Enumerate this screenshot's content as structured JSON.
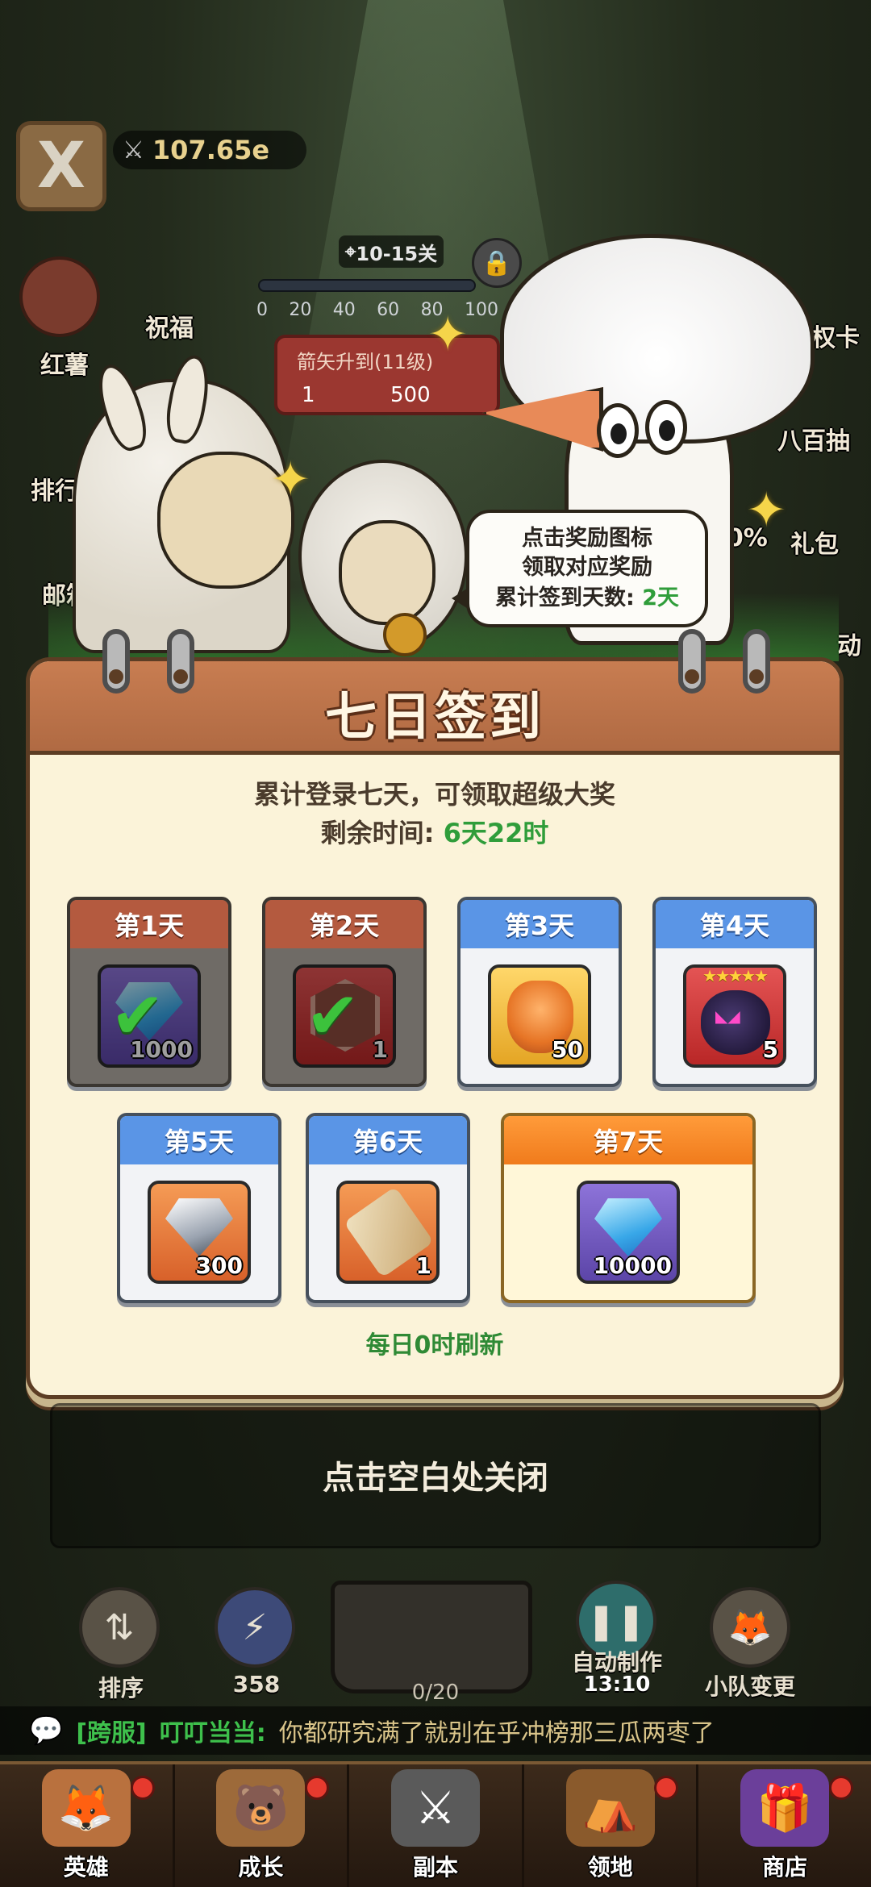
{
  "top_bar": {
    "close_glyph": "X",
    "power_value": "107.65e"
  },
  "side_menu": {
    "left": [
      "红薯",
      "祝福",
      "排行",
      "邮箱"
    ],
    "right": [
      "特权卡",
      "八百抽",
      "礼包",
      "动"
    ],
    "right_fragment": "00%"
  },
  "stage": {
    "tag": "10-15关",
    "progress_ticks": [
      "0",
      "20",
      "40",
      "60",
      "80",
      "100"
    ],
    "reward_title": "箭矢升到(11级)",
    "reward_gem_count": "1",
    "reward_diamond_count": "500"
  },
  "speech_bubble": {
    "line1": "点击奖励图标",
    "line2": "领取对应奖励",
    "line3_label": "累计签到天数:",
    "line3_value": "2天"
  },
  "panel": {
    "title": "七日签到",
    "subtitle": "累计登录七天，可领取超级大奖",
    "remaining_label": "剩余时间:",
    "remaining_value": "6天22时",
    "refresh_note": "每日0时刷新",
    "days": [
      {
        "label": "第1天",
        "count": "1000",
        "claimed": true,
        "item": "blue-diamond-icon"
      },
      {
        "label": "第2天",
        "count": "1",
        "claimed": true,
        "item": "hex-token-icon"
      },
      {
        "label": "第3天",
        "count": "50",
        "claimed": false,
        "item": "fox-hero-icon"
      },
      {
        "label": "第4天",
        "count": "5",
        "claimed": false,
        "item": "crow-hero-icon",
        "stars": "★★★★★"
      },
      {
        "label": "第5天",
        "count": "300",
        "claimed": false,
        "item": "white-diamond-icon"
      },
      {
        "label": "第6天",
        "count": "1",
        "claimed": false,
        "item": "scroll-icon"
      },
      {
        "label": "第7天",
        "count": "10000",
        "claimed": false,
        "item": "blue-diamond-icon"
      }
    ]
  },
  "close_hint": "点击空白处关闭",
  "actions": {
    "sort_label": "排序",
    "energy_value": "358",
    "forge_count": "0/20",
    "auto_label": "自动制作",
    "auto_time": "13:10",
    "squad_label": "小队变更"
  },
  "chat": {
    "channel": "[跨服]",
    "name": "叮叮当当:",
    "message": "你都研究满了就别在乎冲榜那三瓜两枣了"
  },
  "bottom_nav": [
    "英雄",
    "成长",
    "副本",
    "领地",
    "商店"
  ],
  "colors": {
    "panel_bg": "#fbf3d9",
    "header_wood": "#c87d51",
    "day_blue": "#5a95e6",
    "day_claimed": "#b45a3f",
    "day7_orange": "#f07b1c",
    "highlight_green": "#2f9d3a"
  }
}
